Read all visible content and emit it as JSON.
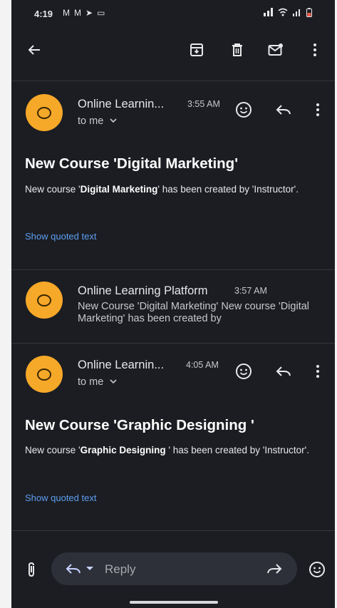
{
  "status_bar": {
    "time": "4:19",
    "left_icons": [
      "M",
      "M",
      "➤",
      "▭"
    ],
    "right_icons": [
      "signal-icon",
      "wifi-icon",
      "bars-icon",
      "battery-icon"
    ]
  },
  "toolbar": {
    "back_icon": "arrow-left-icon",
    "archive_icon": "archive-icon",
    "delete_icon": "trash-icon",
    "mark_unread_icon": "mail-unread-icon",
    "more_icon": "more-vertical-icon"
  },
  "messages": [
    {
      "sender": "Online Learnin...",
      "time": "3:55 AM",
      "to": "to me",
      "subject": "New Course 'Digital Marketing'",
      "body_pre": "New course '",
      "body_bold": "Digital Marketing",
      "body_post": "' has been created by 'Instructor'.",
      "show_quoted": "Show quoted text"
    },
    {
      "sender": "Online Learning Platform",
      "time": "3:57 AM",
      "preview": "New Course 'Digital Marketing' New course 'Digital Marketing' has been created by"
    },
    {
      "sender": "Online Learnin...",
      "time": "4:05 AM",
      "to": "to me",
      "subject": "New Course 'Graphic Designing '",
      "body_pre": "New course '",
      "body_bold": "Graphic Designing",
      "body_post": " ' has been created by 'Instructor'.",
      "show_quoted": "Show quoted text"
    }
  ],
  "composer": {
    "reply_label": "Reply"
  },
  "colors": {
    "background": "#1b1d22",
    "avatar": "#f6a829",
    "link": "#5e9ef2",
    "pill": "#2d3039"
  }
}
